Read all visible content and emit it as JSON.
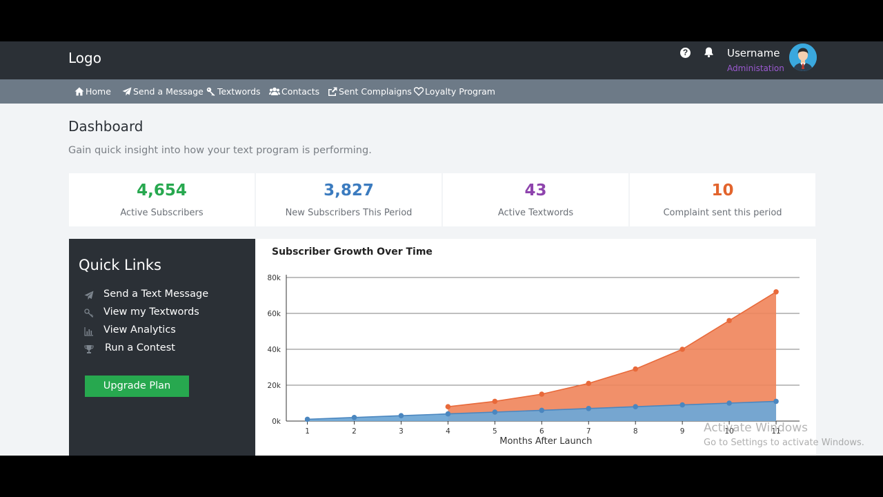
{
  "header": {
    "logo": "Logo",
    "username": "Username",
    "role": "Administation",
    "icons": [
      "help-icon",
      "bell-icon",
      "avatar"
    ]
  },
  "nav": {
    "items": [
      {
        "label": "Home",
        "icon": "home-icon"
      },
      {
        "label": "Send a Message",
        "icon": "paper-plane-icon"
      },
      {
        "label": "Textwords",
        "icon": "key-icon"
      },
      {
        "label": "Contacts",
        "icon": "users-icon"
      },
      {
        "label": "Sent Complaigns",
        "icon": "share-icon"
      },
      {
        "label": "Loyalty Program",
        "icon": "heart-icon"
      }
    ]
  },
  "page": {
    "title": "Dashboard",
    "subtitle": "Gain quick insight into how your text program is performing."
  },
  "stats": [
    {
      "value": "4,654",
      "label": "Active Subscribers",
      "color": "#27a84f"
    },
    {
      "value": "3,827",
      "label": "New Subscribers This Period",
      "color": "#3b7bbf"
    },
    {
      "value": "43",
      "label": "Active Textwords",
      "color": "#8e44ad"
    },
    {
      "value": "10",
      "label": "Complaint sent this period",
      "color": "#e2642d"
    }
  ],
  "quick_links": {
    "title": "Quick Links",
    "items": [
      {
        "label": "Send a Text Message",
        "icon": "paper-plane-icon"
      },
      {
        "label": "View my Textwords",
        "icon": "key-icon"
      },
      {
        "label": "View Analytics",
        "icon": "bar-chart-icon"
      },
      {
        "label": "Run a Contest",
        "icon": "trophy-icon"
      }
    ],
    "button": "Upgrade Plan"
  },
  "chart": {
    "title": "Subscriber Growth Over Time"
  },
  "chart_data": {
    "type": "area",
    "title": "Subscriber Growth Over Time",
    "xlabel": "Months After Launch",
    "ylabel": "",
    "x": [
      1,
      2,
      3,
      4,
      5,
      6,
      7,
      8,
      9,
      10,
      11
    ],
    "ylim": [
      0,
      80000
    ],
    "yticks": [
      "0k",
      "20k",
      "40k",
      "60k",
      "80k"
    ],
    "grid": true,
    "series": [
      {
        "color": "#f0845a",
        "x": [
          4,
          5,
          6,
          7,
          8,
          9,
          10,
          11
        ],
        "values": [
          8000,
          11000,
          15000,
          21000,
          29000,
          40000,
          56000,
          72000
        ]
      },
      {
        "color": "#6fa8d6",
        "x": [
          1,
          2,
          3,
          4,
          5,
          6,
          7,
          8,
          9,
          10,
          11
        ],
        "values": [
          1000,
          2000,
          3000,
          4000,
          5000,
          6000,
          7000,
          8000,
          9000,
          10000,
          11000
        ]
      }
    ]
  },
  "watermark": {
    "line1": "Activate Windows",
    "line2": "Go to Settings to activate Windows."
  }
}
